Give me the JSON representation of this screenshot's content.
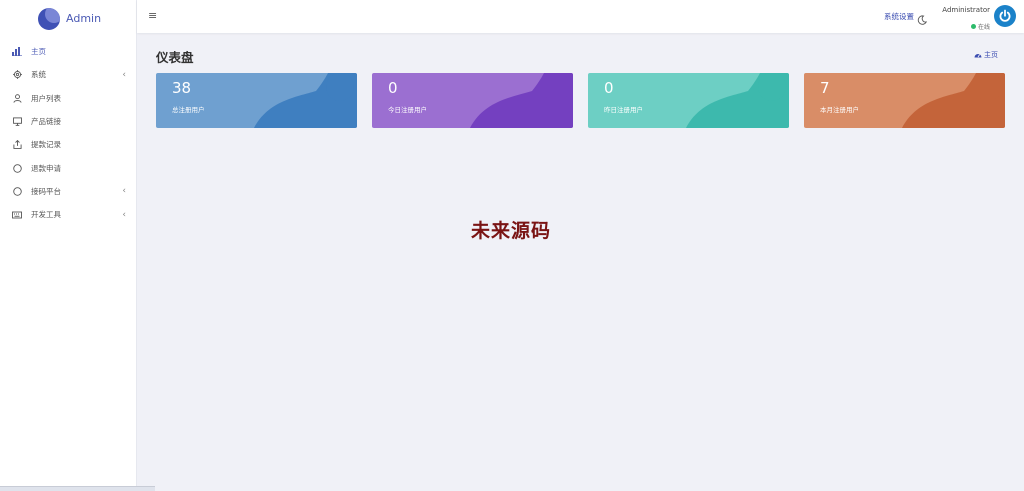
{
  "brand": {
    "name": "Admin"
  },
  "sidebar": {
    "items": [
      {
        "label": "主页",
        "icon": "bar-chart-icon"
      },
      {
        "label": "系统",
        "icon": "gear-icon",
        "has_children": true
      },
      {
        "label": "用户列表",
        "icon": "user-icon"
      },
      {
        "label": "产品链接",
        "icon": "monitor-icon"
      },
      {
        "label": "提款记录",
        "icon": "share-icon"
      },
      {
        "label": "退款申请",
        "icon": "circle-icon"
      },
      {
        "label": "接码平台",
        "icon": "circle-icon",
        "has_children": true
      },
      {
        "label": "开发工具",
        "icon": "keyboard-icon",
        "has_children": true
      }
    ],
    "chevron": "‹"
  },
  "topbar": {
    "menu_icon": "≡",
    "settings_label": "系统设置",
    "user_name": "Administrator",
    "user_status": "在线"
  },
  "page": {
    "title": "仪表盘",
    "breadcrumb": "主页"
  },
  "stats": [
    {
      "value": "38",
      "label": "总注册用户",
      "color": "#6fa0d0",
      "wave": "#3f7fc0"
    },
    {
      "value": "0",
      "label": "今日注册用户",
      "color": "#9b6fd1",
      "wave": "#7440c0"
    },
    {
      "value": "0",
      "label": "昨日注册用户",
      "color": "#6dcfc4",
      "wave": "#3db9ad"
    },
    {
      "value": "7",
      "label": "本月注册用户",
      "color": "#d98d67",
      "wave": "#c4643a"
    }
  ],
  "watermark": "未来源码"
}
